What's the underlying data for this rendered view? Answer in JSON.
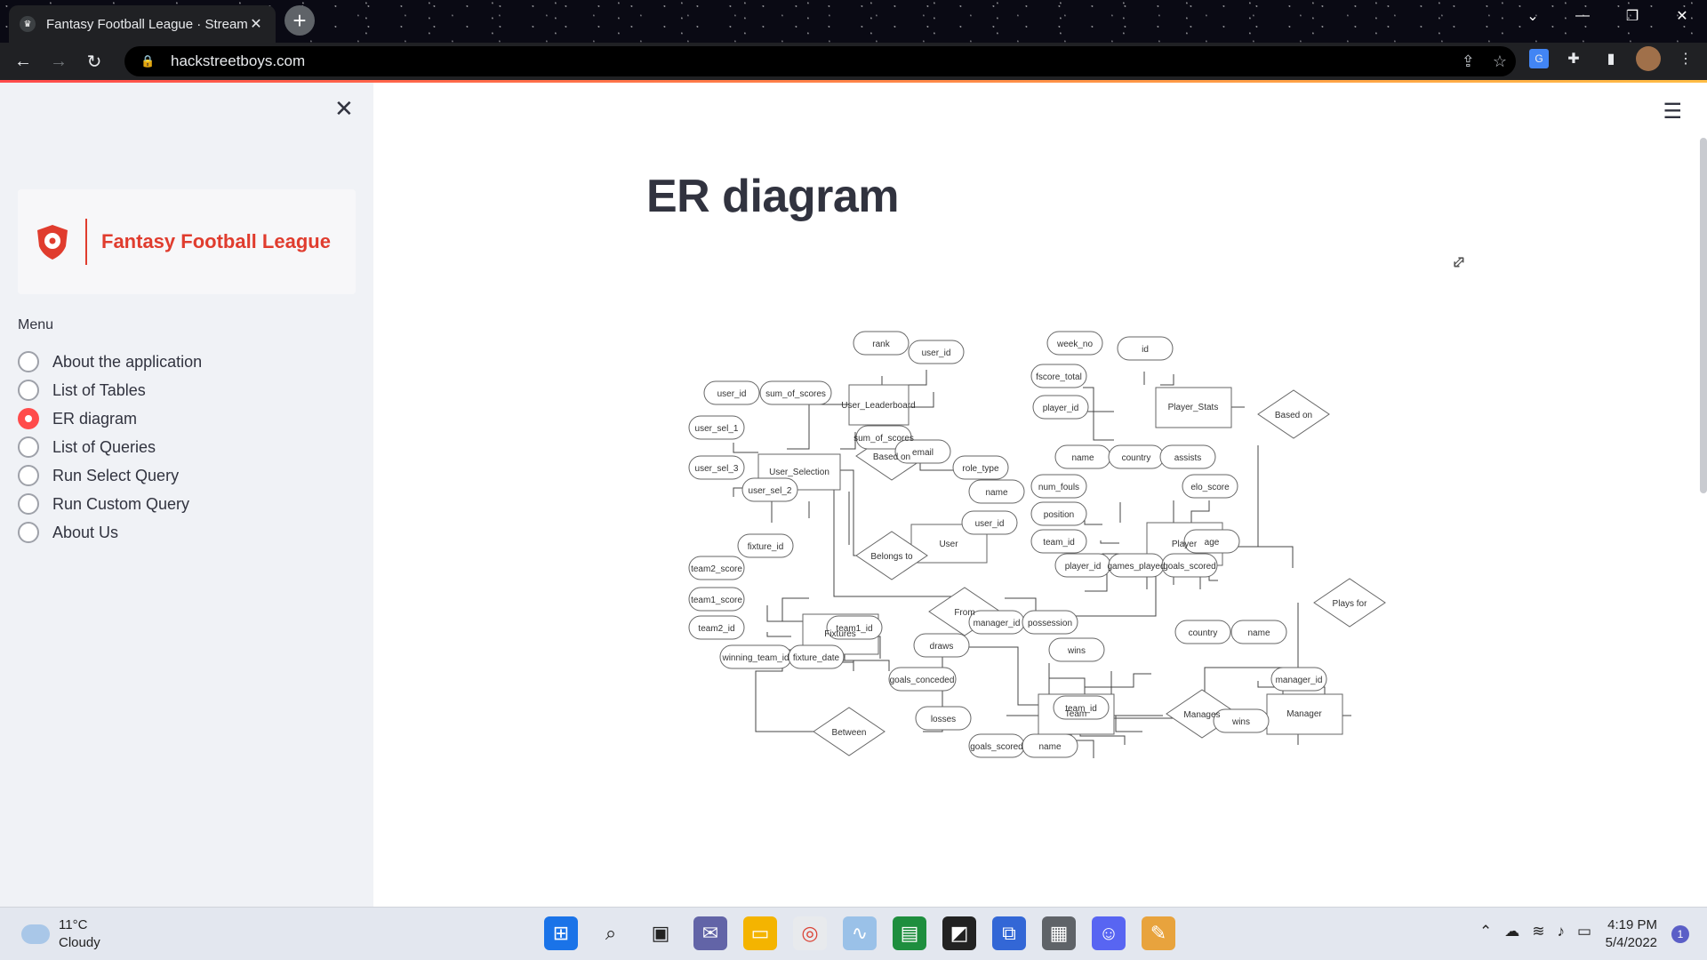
{
  "browser": {
    "tab_title": "Fantasy Football League · Stream",
    "url": "hackstreetboys.com"
  },
  "sidebar": {
    "logo_text": "Fantasy Football League",
    "menu_label": "Menu",
    "items": [
      {
        "label": "About the application",
        "selected": false
      },
      {
        "label": "List of Tables",
        "selected": false
      },
      {
        "label": "ER diagram",
        "selected": true
      },
      {
        "label": "List of Queries",
        "selected": false
      },
      {
        "label": "Run Select Query",
        "selected": false
      },
      {
        "label": "Run Custom Query",
        "selected": false
      },
      {
        "label": "About Us",
        "selected": false
      }
    ]
  },
  "main": {
    "title": "ER diagram"
  },
  "diagram": {
    "entities": [
      "User_Leaderboard",
      "Player_Stats",
      "User_Selection",
      "User",
      "Player",
      "Fixtures",
      "Team",
      "Manager"
    ],
    "relationships": [
      "Based on",
      "Based on",
      "Belongs to",
      "From",
      "Plays for",
      "Between",
      "Manages"
    ],
    "attributes": [
      "rank",
      "user_id",
      "sum_of_scores",
      "week_no",
      "id",
      "fscore_total",
      "player_id",
      "user_id",
      "sum_of_scores",
      "user_sel_1",
      "user_sel_3",
      "user_sel_2",
      "email",
      "role_type",
      "name",
      "user_id",
      "name",
      "country",
      "assists",
      "num_fouls",
      "elo_score",
      "position",
      "team_id",
      "age",
      "player_id",
      "games_played",
      "goals_scored",
      "fixture_id",
      "team2_score",
      "team1_score",
      "team2_id",
      "team1_id",
      "winning_team_id",
      "fixture_date",
      "manager_id",
      "possession",
      "draws",
      "wins",
      "goals_conceded",
      "losses",
      "goals_scored",
      "team_id",
      "name",
      "country",
      "name",
      "manager_id",
      "wins"
    ]
  },
  "taskbar": {
    "temperature": "11°C",
    "weather": "Cloudy",
    "time": "4:19 PM",
    "date": "5/4/2022",
    "notifications": "1"
  },
  "colors": {
    "accent": "#ff4b4b",
    "sidebar_bg": "#f0f2f6",
    "logo_red": "#e03c2e"
  }
}
